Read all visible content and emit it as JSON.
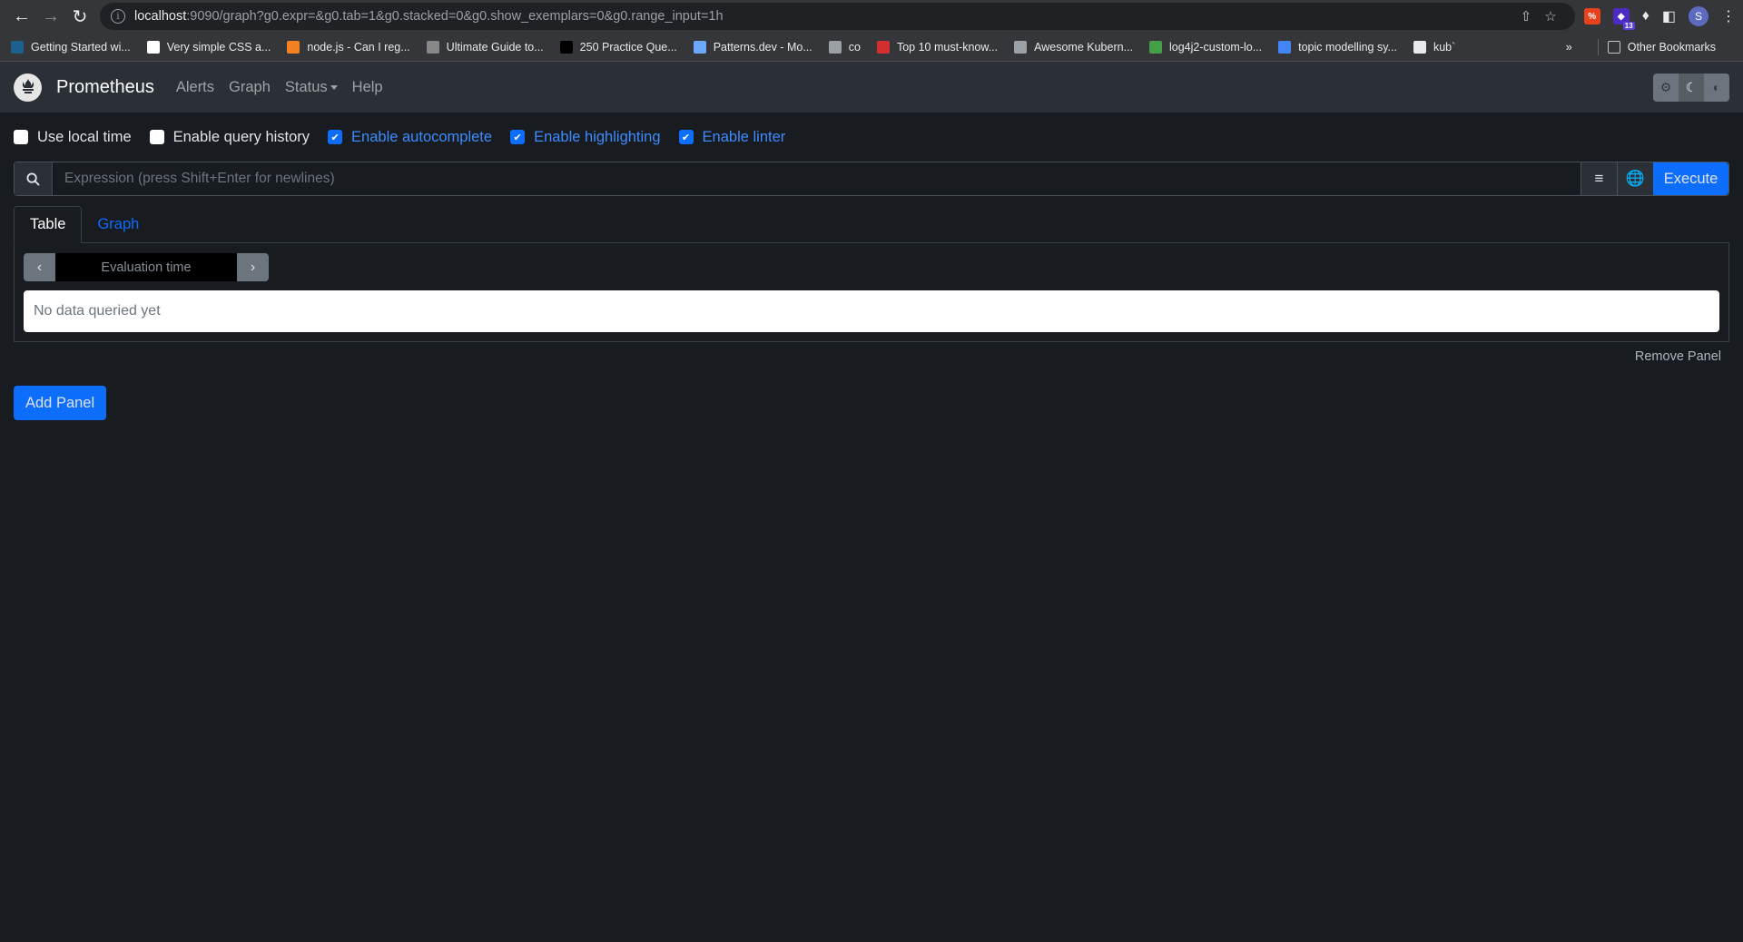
{
  "browser": {
    "url_host": "localhost",
    "url_rest": ":9090/graph?g0.expr=&g0.tab=1&g0.stacked=0&g0.show_exemplars=0&g0.range_input=1h",
    "extension_badge": "13",
    "profile_initial": "S",
    "bookmarks": [
      {
        "label": "Getting Started wi...",
        "icon": "board-icon",
        "color": "#1e5f8c"
      },
      {
        "label": "Very simple CSS a...",
        "icon": "codepen-icon",
        "color": "#ffffff"
      },
      {
        "label": "node.js - Can I reg...",
        "icon": "stackoverflow-icon",
        "color": "#f48024"
      },
      {
        "label": "Ultimate Guide to...",
        "icon": "site-icon",
        "color": "#888888"
      },
      {
        "label": "250 Practice Que...",
        "icon": "medium-icon",
        "color": "#000000"
      },
      {
        "label": "Patterns.dev - Mo...",
        "icon": "patterns-icon",
        "color": "#6ea8fe"
      },
      {
        "label": "co",
        "icon": "globe-icon",
        "color": "#9aa0a6"
      },
      {
        "label": "Top 10 must-know...",
        "icon": "article-icon",
        "color": "#d32f2f"
      },
      {
        "label": "Awesome Kubern...",
        "icon": "globe-icon",
        "color": "#9aa0a6"
      },
      {
        "label": "log4j2-custom-lo...",
        "icon": "leaf-icon",
        "color": "#43a047"
      },
      {
        "label": "topic modelling sy...",
        "icon": "google-icon",
        "color": "#4285f4"
      },
      {
        "label": "kub`",
        "icon": "doc-icon",
        "color": "#e8eaed"
      }
    ],
    "overflow_label": "»",
    "other_bookmarks": "Other Bookmarks"
  },
  "navbar": {
    "brand": "Prometheus",
    "links": [
      "Alerts",
      "Graph",
      "Status",
      "Help"
    ]
  },
  "options": [
    {
      "label": "Use local time",
      "checked": false
    },
    {
      "label": "Enable query history",
      "checked": false
    },
    {
      "label": "Enable autocomplete",
      "checked": true
    },
    {
      "label": "Enable highlighting",
      "checked": true
    },
    {
      "label": "Enable linter",
      "checked": true
    }
  ],
  "query": {
    "value": "",
    "placeholder": "Expression (press Shift+Enter for newlines)",
    "execute_label": "Execute"
  },
  "panel": {
    "tabs": [
      {
        "label": "Table",
        "active": true
      },
      {
        "label": "Graph",
        "active": false
      }
    ],
    "eval_placeholder": "Evaluation time",
    "no_data": "No data queried yet",
    "remove_label": "Remove Panel"
  },
  "add_panel_label": "Add Panel",
  "colors": {
    "accent": "#0d6efd",
    "page_bg": "#181b1f",
    "navbar_bg": "#2b2f36"
  }
}
